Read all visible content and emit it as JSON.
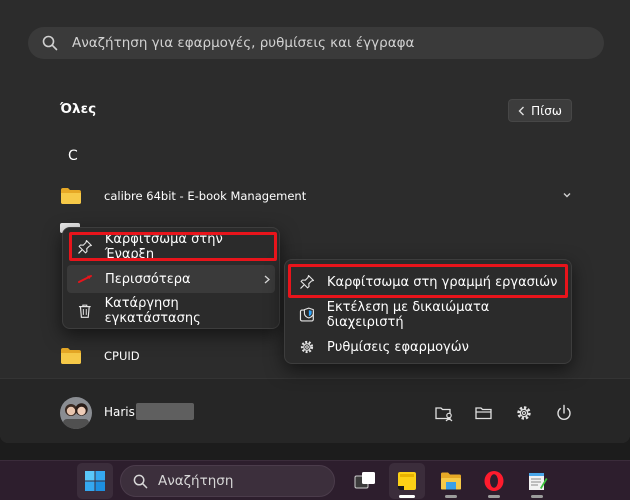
{
  "search": {
    "placeholder": "Αναζήτηση για εφαρμογές, ρυθμίσεις και έγγραφα"
  },
  "header": {
    "all_label": "Όλες",
    "back_label": "Πίσω"
  },
  "letter_group": "C",
  "apps": [
    {
      "label": "calibre 64bit - E-book Management"
    },
    {
      "label": "CPUID"
    }
  ],
  "context_menu": {
    "items": [
      {
        "label": "Καρφίτσωμα στην Έναρξη",
        "icon": "pin-icon"
      },
      {
        "label": "Περισσότερα",
        "icon": "more-icon"
      },
      {
        "label": "Κατάργηση εγκατάστασης",
        "icon": "trash-icon"
      }
    ]
  },
  "sub_menu": {
    "items": [
      {
        "label": "Καρφίτσωμα στη γραμμή εργασιών",
        "icon": "pin-icon"
      },
      {
        "label": "Εκτέλεση με δικαιώματα διαχειριστή",
        "icon": "admin-shield-icon"
      },
      {
        "label": "Ρυθμίσεις εφαρμογών",
        "icon": "gear-icon"
      }
    ]
  },
  "user": {
    "name": "Haris"
  },
  "taskbar": {
    "search_placeholder": "Αναζήτηση"
  },
  "colors": {
    "highlight": "#e8141b",
    "folder": "#f3c13a",
    "accent": "#2fa7ff"
  }
}
